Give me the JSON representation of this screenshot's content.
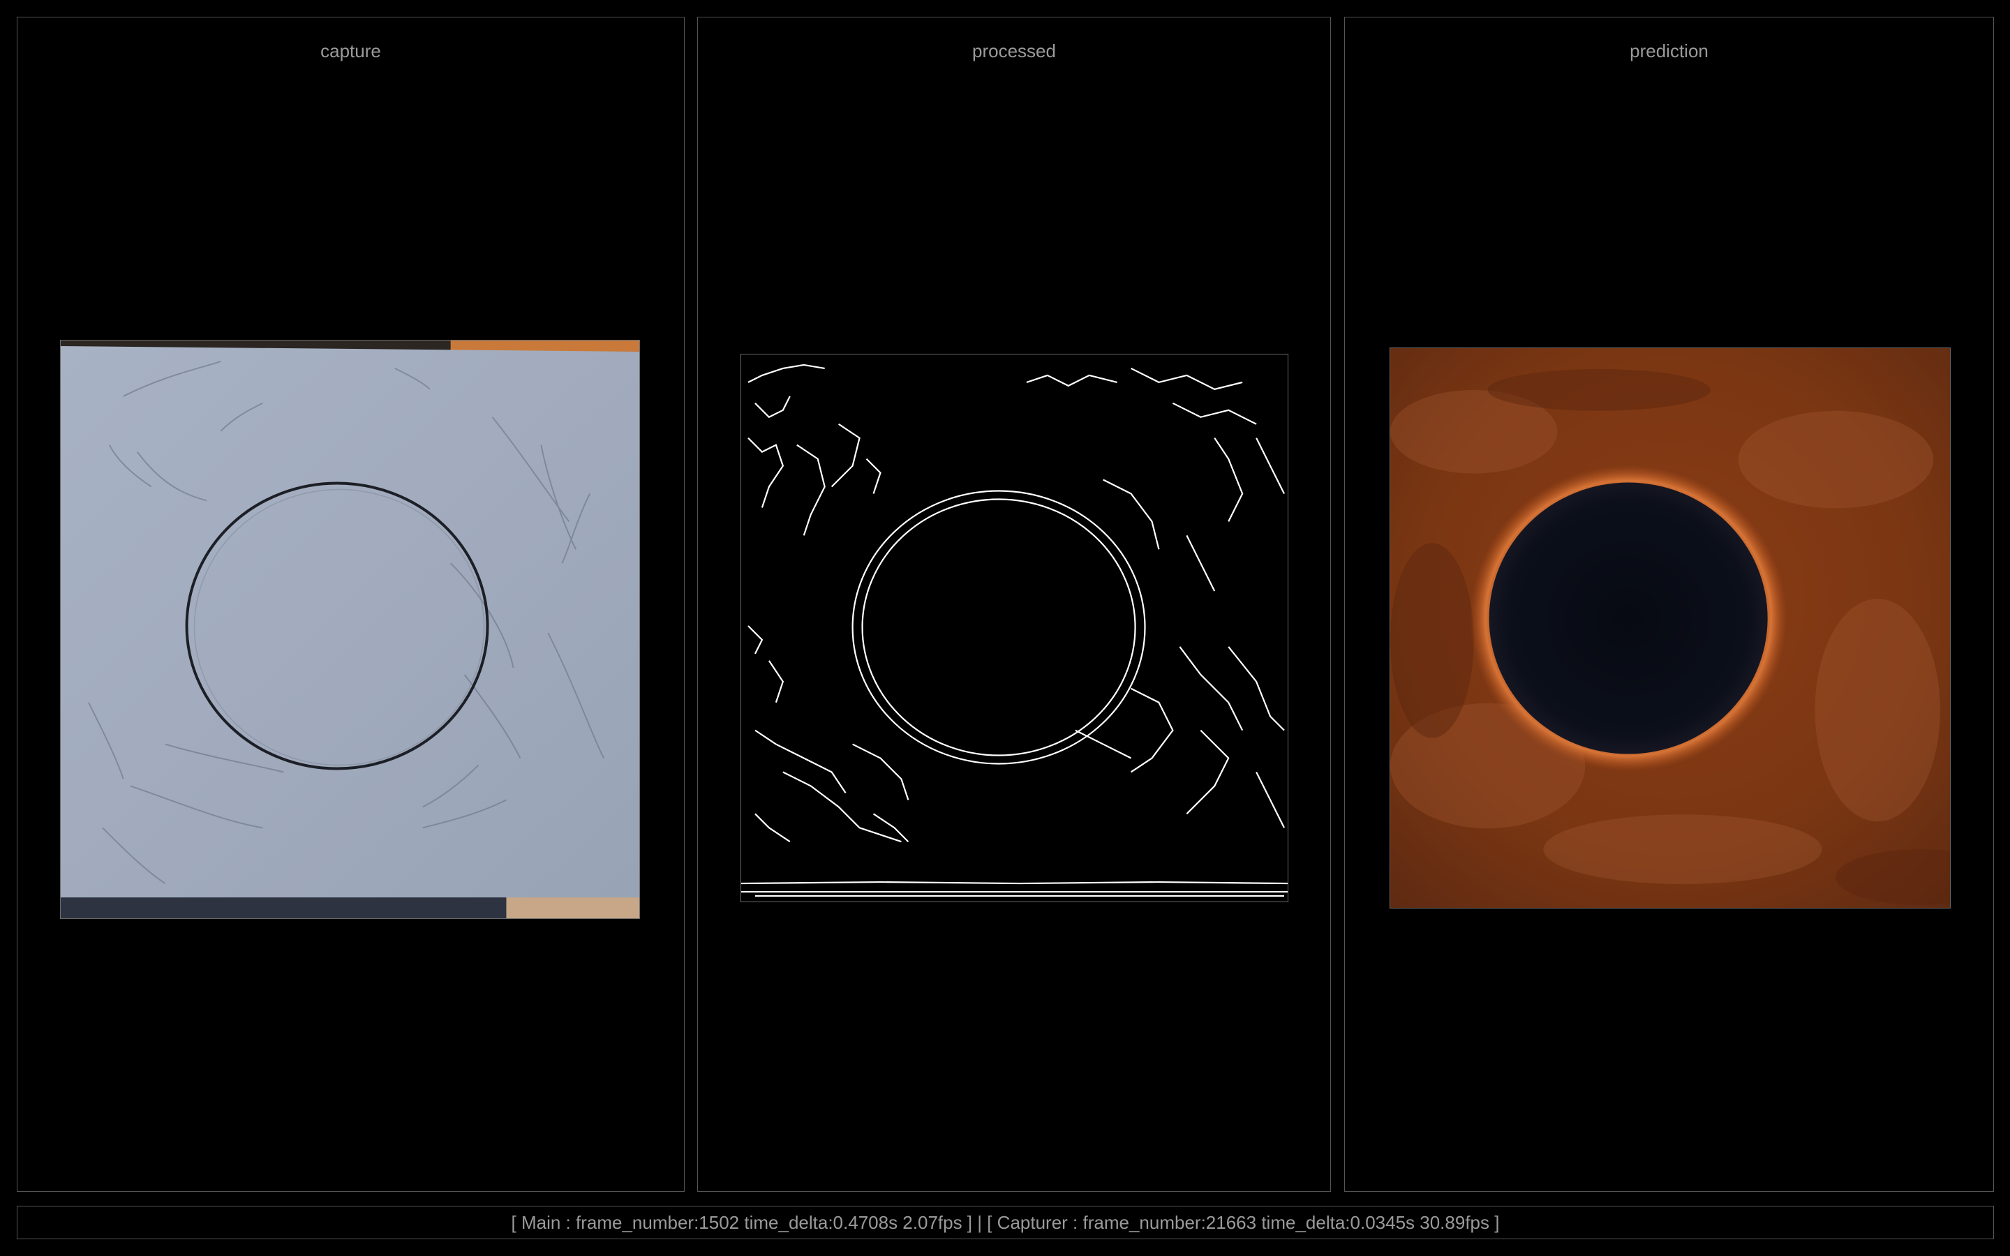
{
  "panels": {
    "capture": {
      "title": "capture"
    },
    "processed": {
      "title": "processed"
    },
    "prediction": {
      "title": "prediction"
    }
  },
  "status": {
    "text": "[ Main : frame_number:1502 time_delta:0.4708s 2.07fps ] | [ Capturer : frame_number:21663 time_delta:0.0345s 30.89fps ]"
  }
}
